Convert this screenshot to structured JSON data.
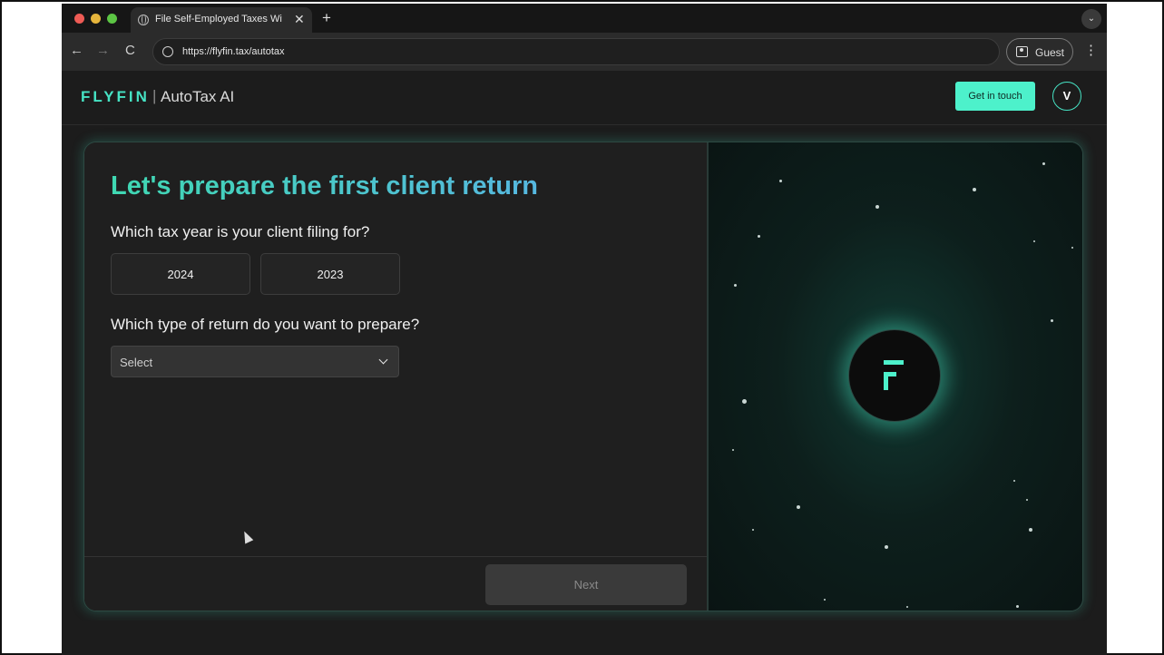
{
  "browser": {
    "tab_title": "File Self-Employed Taxes With",
    "tab_close_glyph": "✕",
    "new_tab_glyph": "+",
    "url": "https://flyfin.tax/autotax",
    "profile_label": "Guest",
    "back_glyph": "←",
    "forward_glyph": "→",
    "reload_glyph": "C",
    "menu_glyph": "⋮",
    "tab_list_glyph": "⌄"
  },
  "header": {
    "brand": "FLYFIN",
    "separator": "|",
    "product": "AutoTax AI",
    "cta_label": "Get in touch",
    "avatar_initial": "V"
  },
  "form": {
    "title": "Let's prepare the first client return",
    "q_tax_year": "Which tax year is your client filing for?",
    "years": [
      "2024",
      "2023"
    ],
    "q_return_type": "Which type of return do you want to prepare?",
    "return_type_value": "Select",
    "next_label": "Next"
  },
  "colors": {
    "accent": "#4df1cb",
    "brand_text": "#46e3c4",
    "heading_gradient_start": "#3fd8b2",
    "heading_gradient_end": "#56b8e0",
    "background": "#1c1c1c"
  },
  "icons": {
    "tab": "globe-icon",
    "site_info": "site-info-icon",
    "profile": "profile-icon",
    "select": "chevron-down-icon",
    "logo": "flyfin-logo-icon"
  }
}
